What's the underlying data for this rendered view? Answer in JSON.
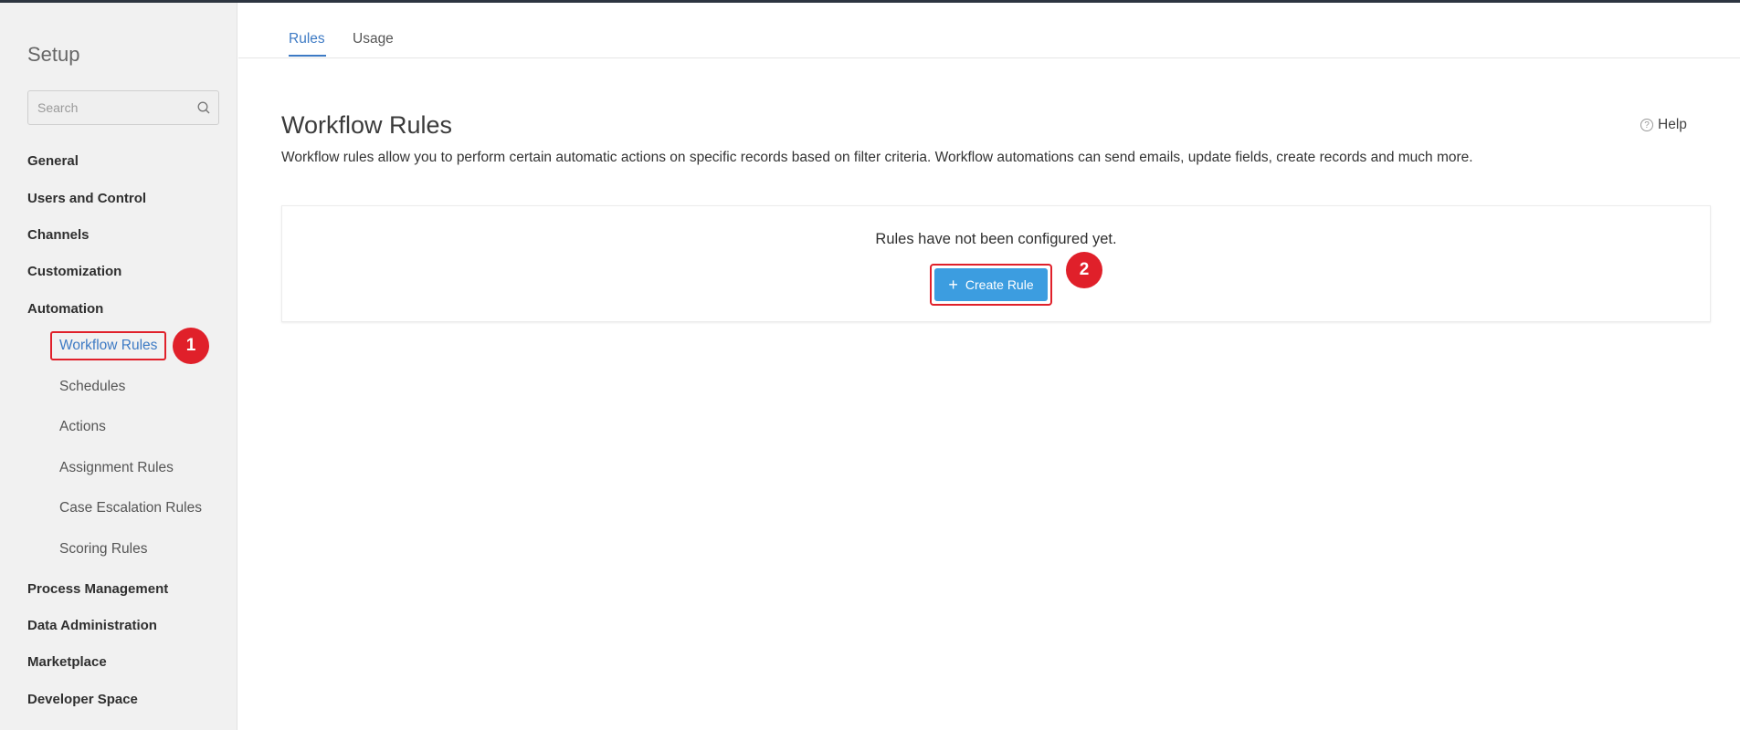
{
  "sidebar": {
    "title": "Setup",
    "search_placeholder": "Search",
    "items": [
      {
        "label": "General"
      },
      {
        "label": "Users and Control"
      },
      {
        "label": "Channels"
      },
      {
        "label": "Customization"
      },
      {
        "label": "Automation"
      },
      {
        "label": "Process Management"
      },
      {
        "label": "Data Administration"
      },
      {
        "label": "Marketplace"
      },
      {
        "label": "Developer Space"
      }
    ],
    "automation_subitems": [
      {
        "label": "Workflow Rules"
      },
      {
        "label": "Schedules"
      },
      {
        "label": "Actions"
      },
      {
        "label": "Assignment Rules"
      },
      {
        "label": "Case Escalation Rules"
      },
      {
        "label": "Scoring Rules"
      }
    ]
  },
  "tabs": [
    {
      "label": "Rules"
    },
    {
      "label": "Usage"
    }
  ],
  "main": {
    "title": "Workflow Rules",
    "help_label": "Help",
    "description": "Workflow rules allow you to perform certain automatic actions on specific records based on filter criteria. Workflow automations can send emails, update fields, create records and much more.",
    "empty_message": "Rules have not been configured yet.",
    "create_button_label": "Create Rule"
  },
  "annotations": {
    "step1": "1",
    "step2": "2"
  },
  "colors": {
    "accent": "#3d7ac4",
    "button": "#3c9de0",
    "highlight": "#e0202a"
  }
}
